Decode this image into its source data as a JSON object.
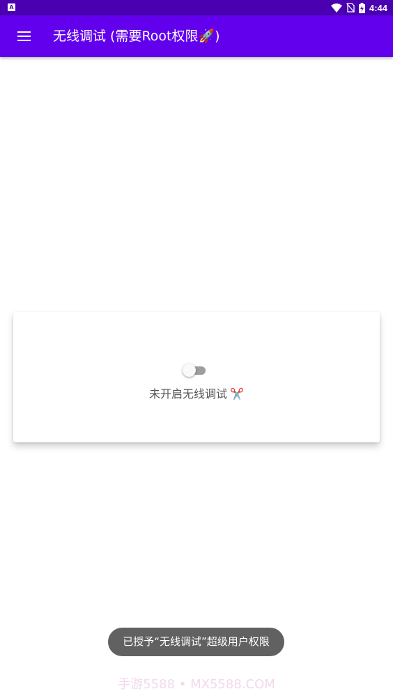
{
  "status_bar": {
    "app_badge": "A",
    "time": "4:44",
    "icons": [
      "wifi-icon",
      "no-sim-icon",
      "battery-charging-icon"
    ],
    "background": "#4a00b0"
  },
  "app_bar": {
    "menu_icon": "hamburger-menu-icon",
    "title": "无线调试 (需要Root权限🚀)",
    "background": "#6200ee"
  },
  "card": {
    "toggle_on": false,
    "status_text": "未开启无线调试",
    "status_icon": "✂️"
  },
  "toast": {
    "message": "已授予“无线调试”超级用户权限"
  },
  "watermark": {
    "text": "手游5588 • MX5588.COM"
  }
}
